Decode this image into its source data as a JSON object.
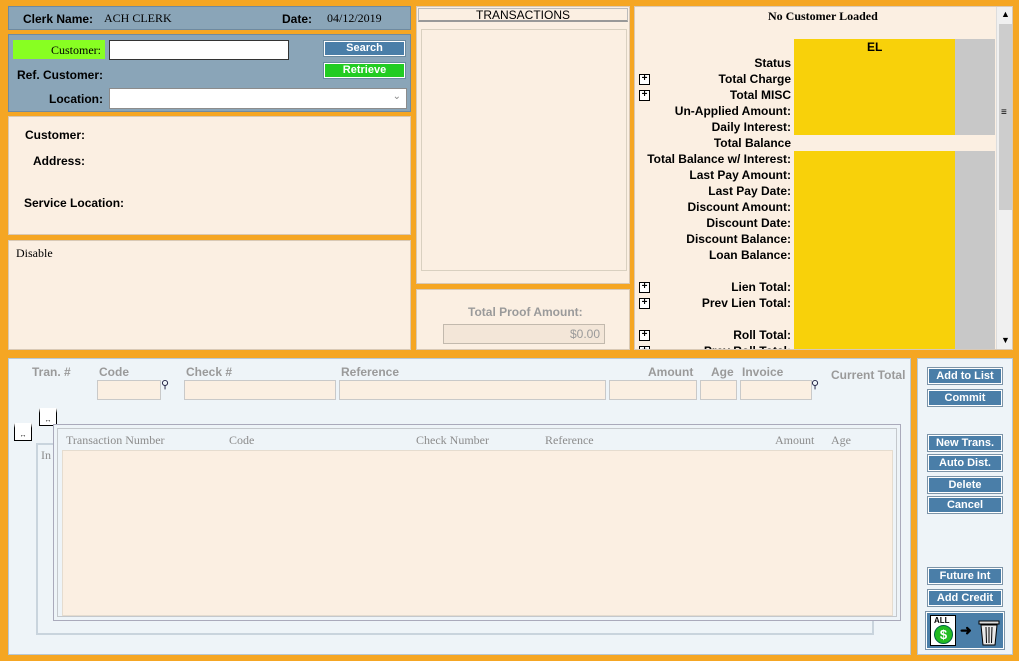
{
  "header": {
    "clerk_label": "Clerk Name:",
    "clerk_value": "ACH CLERK",
    "date_label": "Date:",
    "date_value": "04/12/2019"
  },
  "search": {
    "customer_label": "Customer:",
    "customer_value": "",
    "ref_customer_label": "Ref. Customer:",
    "location_label": "Location:",
    "location_value": "",
    "search_button": "Search",
    "retrieve_button": "Retrieve"
  },
  "customer_info": {
    "customer_label": "Customer:",
    "address_label": "Address:",
    "service_location_label": "Service Location:"
  },
  "disable_box": {
    "text": "Disable"
  },
  "transactions": {
    "title": "TRANSACTIONS",
    "proof_label": "Total Proof Amount:",
    "proof_value": "$0.00"
  },
  "account": {
    "title": "No Customer Loaded",
    "column_header": "EL",
    "rows": [
      {
        "label": "Status",
        "plus": false
      },
      {
        "label": "Total Charge",
        "plus": true
      },
      {
        "label": "Total MISC",
        "plus": true
      },
      {
        "label": "Un-Applied Amount:",
        "plus": false
      },
      {
        "label": "Daily Interest:",
        "plus": false
      },
      {
        "label": "Total Balance",
        "plus": false
      },
      {
        "label": "Total Balance w/ Interest:",
        "plus": false
      },
      {
        "label": "Last Pay Amount:",
        "plus": false
      },
      {
        "label": "Last Pay Date:",
        "plus": false
      },
      {
        "label": "Discount Amount:",
        "plus": false
      },
      {
        "label": "Discount Date:",
        "plus": false
      },
      {
        "label": "Discount Balance:",
        "plus": false
      },
      {
        "label": "Loan Balance:",
        "plus": false
      },
      {
        "label": "",
        "plus": false
      },
      {
        "label": "Lien Total:",
        "plus": true
      },
      {
        "label": "Prev Lien Total:",
        "plus": true
      },
      {
        "label": "",
        "plus": false
      },
      {
        "label": "Roll Total:",
        "plus": true
      },
      {
        "label": "Prev Roll Total:",
        "plus": true
      }
    ]
  },
  "entry": {
    "tran_label": "Tran. #",
    "code_label": "Code",
    "check_label": "Check #",
    "reference_label": "Reference",
    "amount_label": "Amount",
    "age_label": "Age",
    "invoice_label": "Invoice",
    "current_total_label": "Current Total"
  },
  "grid": {
    "columns": [
      "Transaction Number",
      "Code",
      "Check Number",
      "Reference",
      "Amount",
      "Age"
    ],
    "back_header": "In"
  },
  "side_buttons": {
    "add_to_list": "Add to List",
    "commit": "Commit",
    "new_trans": "New Trans.",
    "auto_dist": "Auto Dist.",
    "delete": "Delete",
    "cancel": "Cancel",
    "future_int": "Future Int",
    "add_credit": "Add Credit",
    "all_label": "ALL"
  }
}
